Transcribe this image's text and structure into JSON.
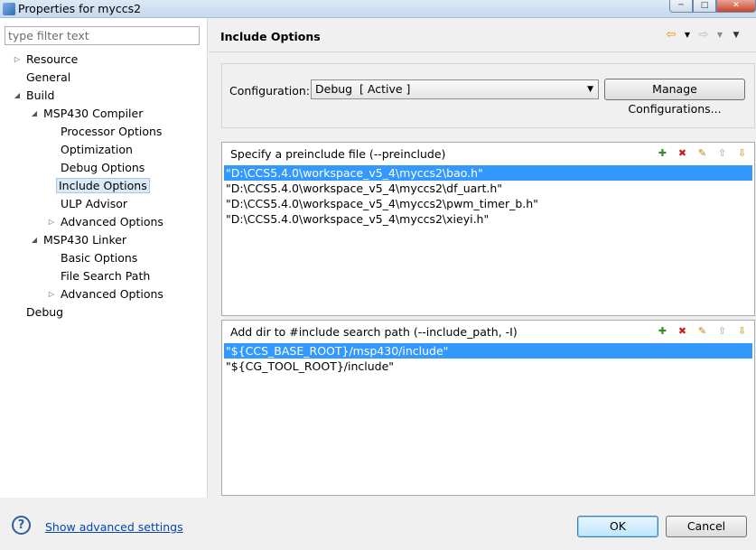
{
  "window": {
    "title": "Properties for myccs2"
  },
  "filter": {
    "placeholder": "type filter text"
  },
  "tree": {
    "items": [
      {
        "label": "Resource"
      },
      {
        "label": "General"
      },
      {
        "label": "Build"
      },
      {
        "label": "MSP430 Compiler"
      },
      {
        "label": "Processor Options"
      },
      {
        "label": "Optimization"
      },
      {
        "label": "Debug Options"
      },
      {
        "label": "Include Options"
      },
      {
        "label": "ULP Advisor"
      },
      {
        "label": "Advanced Options"
      },
      {
        "label": "MSP430 Linker"
      },
      {
        "label": "Basic Options"
      },
      {
        "label": "File Search Path"
      },
      {
        "label": "Advanced Options"
      },
      {
        "label": "Debug"
      }
    ]
  },
  "page": {
    "title": "Include Options"
  },
  "configuration": {
    "label": "Configuration:",
    "selected": "Debug  [ Active ]",
    "manage_label": "Manage Configurations..."
  },
  "preinclude": {
    "heading": "Specify a preinclude file (--preinclude)",
    "items": [
      "\"D:\\CCS5.4.0\\workspace_v5_4\\myccs2\\bao.h\"",
      "\"D:\\CCS5.4.0\\workspace_v5_4\\myccs2\\df_uart.h\"",
      "\"D:\\CCS5.4.0\\workspace_v5_4\\myccs2\\pwm_timer_b.h\"",
      "\"D:\\CCS5.4.0\\workspace_v5_4\\myccs2\\xieyi.h\""
    ]
  },
  "include_path": {
    "heading": "Add dir to #include search path (--include_path, -I)",
    "items": [
      "\"${CCS_BASE_ROOT}/msp430/include\"",
      "\"${CG_TOOL_ROOT}/include\""
    ]
  },
  "footer": {
    "help": "?",
    "advanced_link": "Show advanced settings",
    "ok_label": "OK",
    "cancel_label": "Cancel"
  },
  "icons": {
    "back": "back-arrow-icon",
    "forward": "forward-arrow-icon",
    "menu": "view-menu-icon",
    "add": "add-icon",
    "delete": "delete-icon",
    "edit": "edit-icon",
    "move_up": "move-up-icon",
    "move_down": "move-down-icon"
  },
  "colors": {
    "selection": "#3399ff",
    "link": "#0645ad"
  }
}
